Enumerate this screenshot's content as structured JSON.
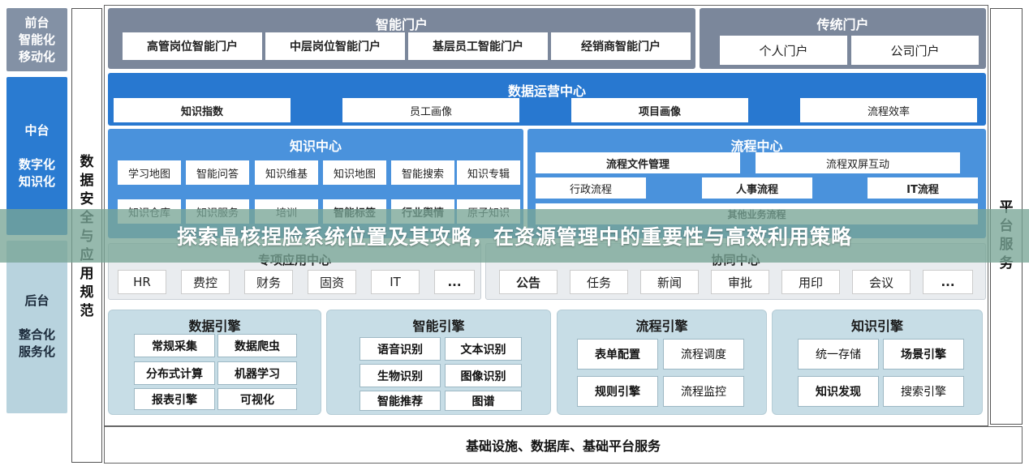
{
  "left_column": {
    "front": {
      "lines": [
        "前台",
        "智能化",
        "移动化"
      ]
    },
    "middle": {
      "lines": [
        "中台",
        "",
        "数字化",
        "知识化"
      ]
    },
    "back": {
      "lines": [
        "后台",
        "",
        "整合化",
        "服务化"
      ]
    }
  },
  "data_security": {
    "chars": [
      "数",
      "据",
      "安",
      "全",
      "与",
      "应",
      "用",
      "规",
      "范"
    ]
  },
  "platform_service": {
    "chars": [
      "平",
      "台",
      "服",
      "务"
    ]
  },
  "smart_portal": {
    "title": "智能门户",
    "items": [
      "高管岗位智能门户",
      "中层岗位智能门户",
      "基层员工智能门户",
      "经销商智能门户"
    ]
  },
  "traditional_portal": {
    "title": "传统门户",
    "items": [
      "个人门户",
      "公司门户"
    ]
  },
  "data_ops": {
    "title": "数据运营中心",
    "items": [
      "知识指数",
      "员工画像",
      "项目画像",
      "流程效率"
    ]
  },
  "knowledge_center": {
    "title": "知识中心",
    "row1": [
      "学习地图",
      "智能问答",
      "知识维基",
      "知识地图",
      "智能搜索",
      "知识专辑"
    ],
    "row2": [
      "知识仓库",
      "知识服务",
      "培训",
      "智能标签",
      "行业舆情",
      "原子知识"
    ]
  },
  "process_center": {
    "title": "流程中心",
    "row1": [
      "流程文件管理",
      "流程双屏互动"
    ],
    "row2": [
      "行政流程",
      "人事流程",
      "IT流程"
    ],
    "other": "其他业务流程"
  },
  "special_apps": {
    "title": "专项应用中心",
    "items": [
      "HR",
      "费控",
      "财务",
      "固资",
      "IT",
      "..."
    ]
  },
  "collaboration": {
    "title": "协同中心",
    "items": [
      "公告",
      "任务",
      "新闻",
      "审批",
      "用印",
      "会议",
      "..."
    ]
  },
  "engines": [
    {
      "title": "数据引擎",
      "items": [
        "常规采集",
        "数据爬虫",
        "分布式计算",
        "机器学习",
        "报表引擎",
        "可视化"
      ]
    },
    {
      "title": "智能引擎",
      "items": [
        "语音识别",
        "文本识别",
        "生物识别",
        "图像识别",
        "智能推荐",
        "图谱"
      ]
    },
    {
      "title": "流程引擎",
      "items": [
        "表单配置",
        "流程调度",
        "规则引擎",
        "流程监控"
      ]
    },
    {
      "title": "知识引擎",
      "items": [
        "统一存储",
        "场景引擎",
        "知识发现",
        "搜索引擎"
      ]
    }
  ],
  "infrastructure": {
    "label": "基础设施、数据库、基础平台服务"
  },
  "banner": {
    "text": "探索晶核捏脸系统位置及其攻略，在资源管理中的重要性与高效利用策略"
  },
  "colors": {
    "portal_gray": "#7b879b",
    "blue": "#2878d0",
    "light_blue": "#4a92dc",
    "side_gray": "#8391a5",
    "side_blue": "#2a7bd1",
    "side_teal": "#b8d3de",
    "engine_bg": "#c7dde6"
  }
}
